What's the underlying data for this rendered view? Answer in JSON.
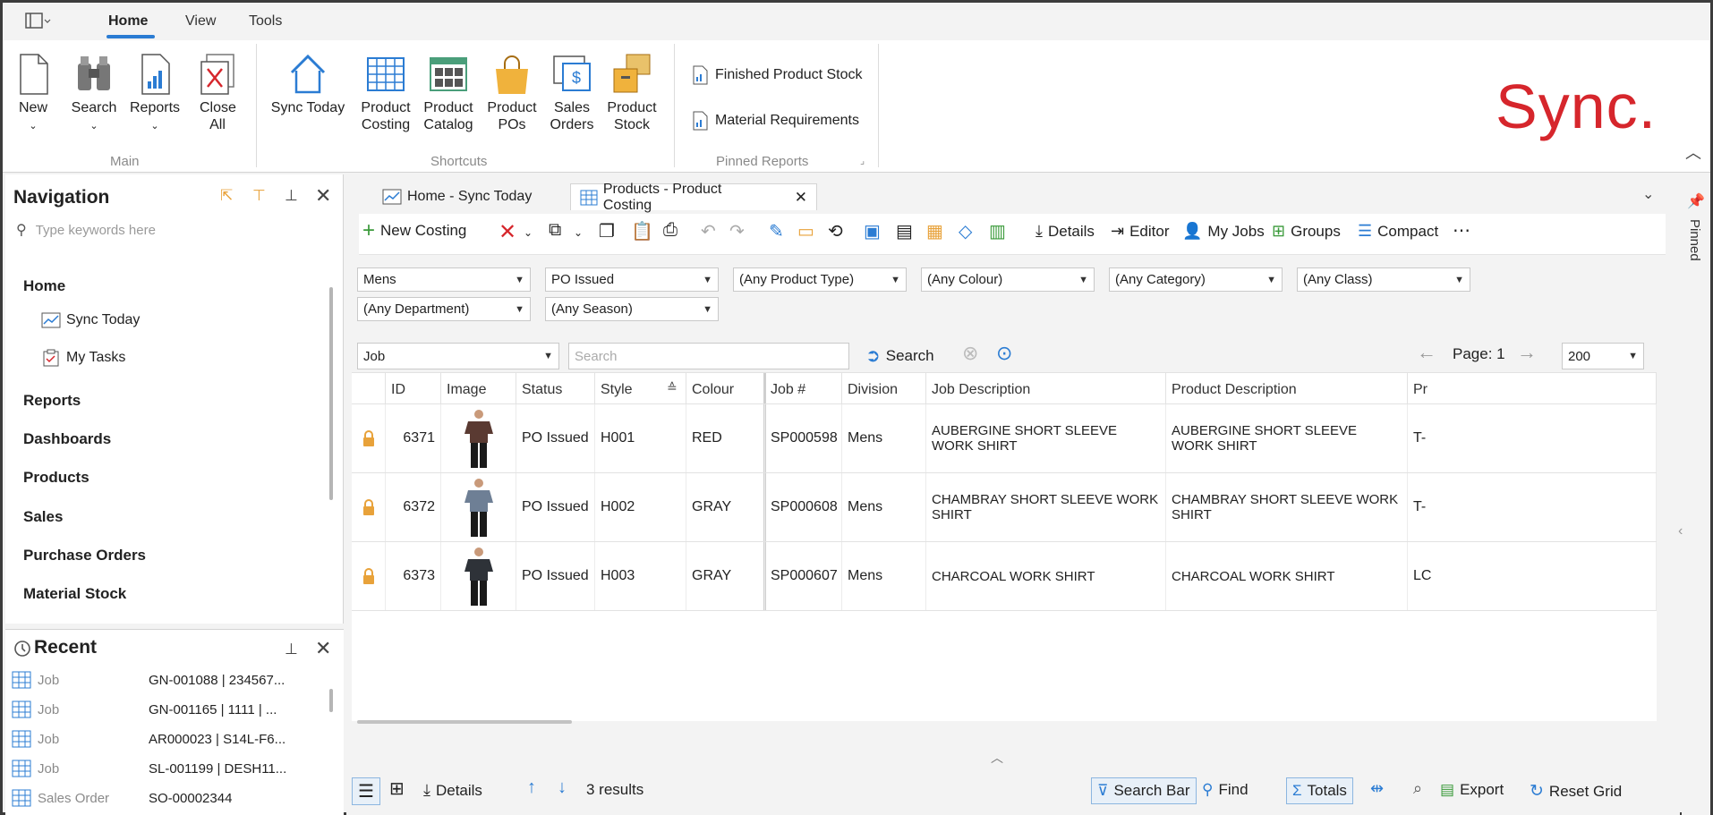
{
  "menu_tabs": [
    "Home",
    "View",
    "Tools"
  ],
  "ribbon": {
    "main": {
      "label": "Main",
      "buttons": [
        "New",
        "Search",
        "Reports",
        "Close All"
      ]
    },
    "shortcuts": {
      "label": "Shortcuts",
      "buttons": [
        "Sync Today",
        "Product Costing",
        "Product Catalog",
        "Product POs",
        "Sales Orders",
        "Product Stock"
      ]
    },
    "pinned": {
      "label": "Pinned Reports",
      "items": [
        "Finished Product Stock",
        "Material Requirements"
      ]
    },
    "logo_text": "Sync."
  },
  "navigation": {
    "title": "Navigation",
    "search_placeholder": "Type keywords here",
    "home": "Home",
    "home_items": [
      "Sync Today",
      "My Tasks"
    ],
    "sections": [
      "Reports",
      "Dashboards",
      "Products",
      "Sales",
      "Purchase Orders",
      "Material Stock"
    ]
  },
  "recent": {
    "title": "Recent",
    "rows": [
      {
        "type": "Job",
        "value": "GN-001088 | 234567..."
      },
      {
        "type": "Job",
        "value": "GN-001165 | 1111 | ..."
      },
      {
        "type": "Job",
        "value": "AR000023 | S14L-F6..."
      },
      {
        "type": "Job",
        "value": "SL-001199 | DESH11..."
      },
      {
        "type": "Sales Order",
        "value": "SO-00002344"
      }
    ]
  },
  "doc_tabs": [
    "Home - Sync Today",
    "Products - Product Costing"
  ],
  "toolbar": {
    "new_costing": "New Costing",
    "details": "Details",
    "editor": "Editor",
    "my_jobs": "My Jobs",
    "groups": "Groups",
    "compact": "Compact"
  },
  "filters": [
    "Mens",
    "PO Issued",
    "(Any Product Type)",
    "(Any Colour)",
    "(Any Category)",
    "(Any Class)",
    "(Any Department)",
    "(Any Season)"
  ],
  "search": {
    "field": "Job",
    "placeholder": "Search",
    "button": "Search",
    "page_label": "Page: 1",
    "page_size": "200"
  },
  "grid": {
    "columns": [
      "ID",
      "Image",
      "Status",
      "Style",
      "Colour",
      "Job #",
      "Division",
      "Job Description",
      "Product Description",
      "Pr"
    ],
    "rows": [
      {
        "id": "6371",
        "status": "PO Issued",
        "style": "H001",
        "colour": "RED",
        "job": "SP000598",
        "division": "Mens",
        "job_desc": "AUBERGINE SHORT SLEEVE WORK SHIRT",
        "prod_desc": "AUBERGINE SHORT SLEEVE WORK SHIRT",
        "pr": "T-"
      },
      {
        "id": "6372",
        "status": "PO Issued",
        "style": "H002",
        "colour": "GRAY",
        "job": "SP000608",
        "division": "Mens",
        "job_desc": "CHAMBRAY SHORT SLEEVE WORK SHIRT",
        "prod_desc": "CHAMBRAY SHORT SLEEVE WORK SHIRT",
        "pr": "T-"
      },
      {
        "id": "6373",
        "status": "PO Issued",
        "style": "H003",
        "colour": "GRAY",
        "job": "SP000607",
        "division": "Mens",
        "job_desc": "CHARCOAL WORK SHIRT",
        "prod_desc": "CHARCOAL WORK SHIRT",
        "pr": "LC"
      }
    ]
  },
  "statusbar": {
    "details": "Details",
    "results": "3 results",
    "search_bar": "Search Bar",
    "find": "Find",
    "totals": "Totals",
    "export": "Export",
    "reset_grid": "Reset Grid"
  },
  "pinned_rail": "Pinned",
  "colors": {
    "accent": "#2b7cd3",
    "logo": "#d6262c",
    "lock": "#e8a23a"
  }
}
